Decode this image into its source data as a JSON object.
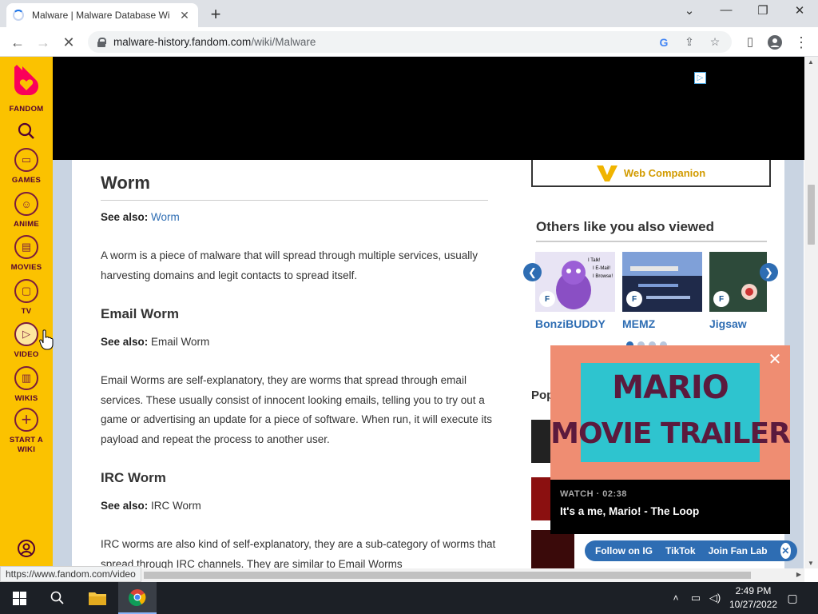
{
  "browser": {
    "tab_title": "Malware | Malware Database Wi",
    "url_host": "malware-history.fandom.com",
    "url_path": "/wiki/Malware",
    "status_url": "https://www.fandom.com/video"
  },
  "rail": {
    "logo_label": "FANDOM",
    "items": [
      {
        "label": "GAMES",
        "icon": "gamepad-icon"
      },
      {
        "label": "ANIME",
        "icon": "anime-face-icon"
      },
      {
        "label": "MOVIES",
        "icon": "clapperboard-icon"
      },
      {
        "label": "TV",
        "icon": "tv-icon"
      },
      {
        "label": "VIDEO",
        "icon": "play-icon"
      },
      {
        "label": "WIKIS",
        "icon": "book-icon"
      },
      {
        "label": "START A",
        "label2": "WIKI",
        "icon": "plus-icon"
      }
    ]
  },
  "article": {
    "h2": "Worm",
    "worm_see_also_label": "See also:",
    "worm_see_also_link": "Worm",
    "worm_para": "A worm is a piece of malware that will spread through multiple services, usually harvesting domains and legit contacts to spread itself.",
    "email_h3": "Email Worm",
    "email_see_also_label": "See also:",
    "email_see_also_text": "Email Worm",
    "email_para": "Email Worms are self-explanatory, they are worms that spread through email services. These usually consist of innocent looking emails, telling you to try out a game or advertising an update for a piece of software. When run, it will execute its payload and repeat the process to another user.",
    "irc_h3": "IRC Worm",
    "irc_see_also_label": "See also:",
    "irc_see_also_text": "IRC Worm",
    "irc_para": "IRC worms are also kind of self-explanatory, they are a sub-category of worms that spread through IRC channels. They are similar to Email Worms"
  },
  "sidebar": {
    "web_companion": "Web Companion",
    "others_title": "Others like you also viewed",
    "cards": [
      {
        "label": "BonziBUDDY"
      },
      {
        "label": "MEMZ"
      },
      {
        "label": "Jigsaw"
      }
    ],
    "popular_title": "Popular"
  },
  "video": {
    "line1": "MARIO",
    "line2": "MOVIE TRAILER",
    "meta": "WATCH · 02:38",
    "name": "It's a me, Mario! - The Loop"
  },
  "social": {
    "ig": "Follow on IG",
    "tiktok": "TikTok",
    "fanlab": "Join Fan Lab"
  },
  "taskbar": {
    "time": "2:49 PM",
    "date": "10/27/2022"
  },
  "colors": {
    "fandom_yellow": "#fbc200",
    "fandom_maroon": "#520032",
    "link_blue": "#2e6db3"
  }
}
